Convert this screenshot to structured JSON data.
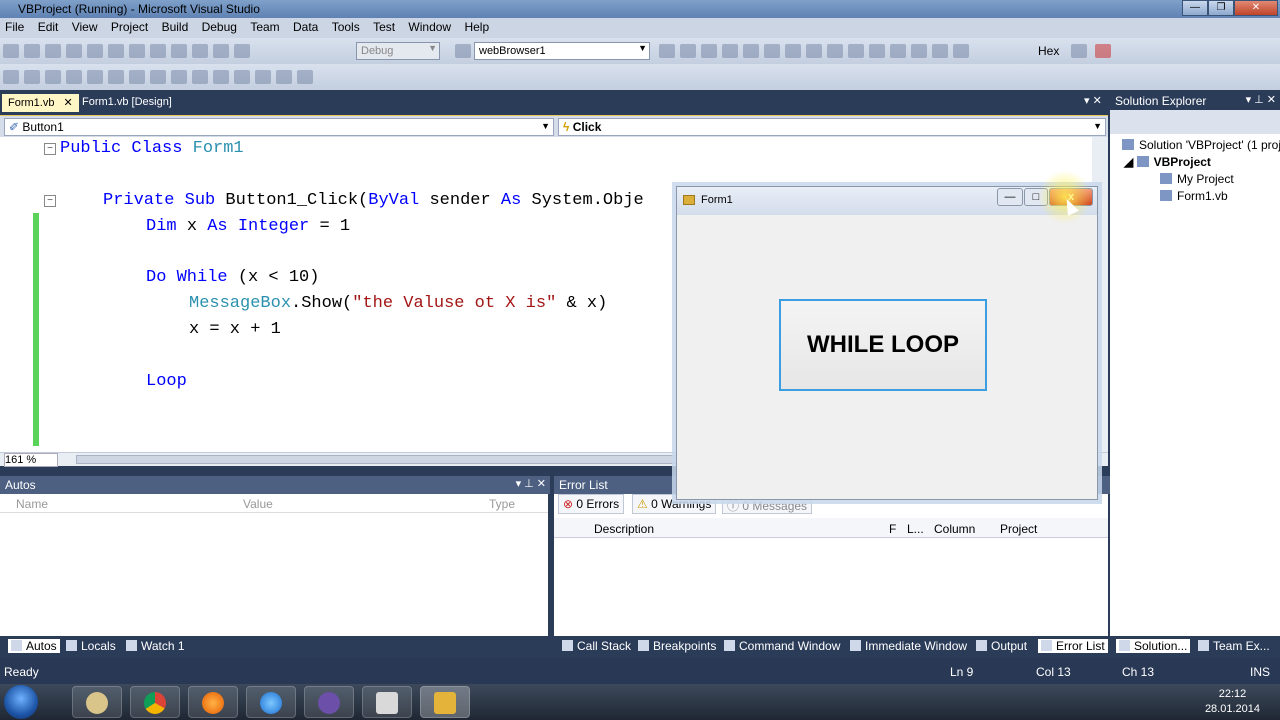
{
  "window": {
    "title": "VBProject (Running) - Microsoft Visual Studio"
  },
  "menu": [
    "File",
    "Edit",
    "View",
    "Project",
    "Build",
    "Debug",
    "Team",
    "Data",
    "Tools",
    "Test",
    "Window",
    "Help"
  ],
  "toolbar": {
    "config_combo": "Debug",
    "target_combo": "webBrowser1",
    "hex_label": "Hex"
  },
  "tabs": {
    "code": "Form1.vb",
    "design": "Form1.vb [Design]"
  },
  "nav": {
    "object": "Button1",
    "event": "Click"
  },
  "code": {
    "l1_kw": "Public Class",
    "l1_name": "Form1",
    "l2_a": "Private Sub",
    "l2_b": "Button1_Click(",
    "l2_c": "ByVal",
    "l2_d": "sender",
    "l2_e": "As",
    "l2_f": "System.Obje",
    "l3_a": "Dim",
    "l3_b": "x",
    "l3_c": "As",
    "l3_d": "Integer",
    "l3_e": "= 1",
    "l4_a": "Do While",
    "l4_b": "(x < 10)",
    "l5_a": "MessageBox",
    "l5_b": ".Show(",
    "l5_c": "\"the Valuse ot X is\"",
    "l5_d": " & x)",
    "l6": "x = x + 1",
    "l7": "Loop"
  },
  "zoom": "161 %",
  "autos": {
    "title": "Autos",
    "cols": [
      "Name",
      "Value",
      "Type"
    ]
  },
  "errors": {
    "title": "Error List",
    "errors": "0 Errors",
    "warnings": "0 Warnings",
    "messages": "0 Messages",
    "cols": [
      "Description",
      "F",
      "L...",
      "Column",
      "Project"
    ]
  },
  "bottom_tabs_left": [
    "Autos",
    "Locals",
    "Watch 1"
  ],
  "bottom_tabs_right": [
    "Call Stack",
    "Breakpoints",
    "Command Window",
    "Immediate Window",
    "Output",
    "Error List"
  ],
  "solution_explorer": {
    "title": "Solution Explorer",
    "solution": "Solution 'VBProject' (1 proj",
    "project": "VBProject",
    "my_project": "My Project",
    "form": "Form1.vb",
    "tab1": "Solution...",
    "tab2": "Team Ex..."
  },
  "status": {
    "ready": "Ready",
    "ln": "Ln 9",
    "col": "Col 13",
    "ch": "Ch 13",
    "ins": "INS"
  },
  "form1": {
    "title": "Form1",
    "button": "WHILE LOOP",
    "close": "x",
    "max": "□",
    "min": "—"
  },
  "clock": {
    "time": "22:12",
    "date": "28.01.2014"
  }
}
